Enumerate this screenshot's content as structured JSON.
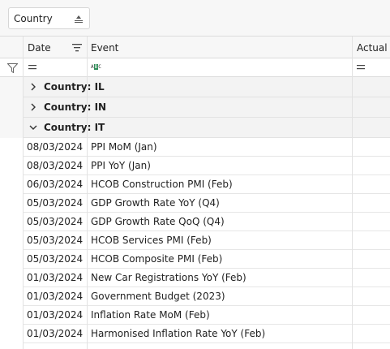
{
  "group_panel": {
    "chip_label": "Country"
  },
  "columns": {
    "date": "Date",
    "event": "Event",
    "actual": "Actual"
  },
  "groups": [
    {
      "label": "Country: IL",
      "expanded": false
    },
    {
      "label": "Country: IN",
      "expanded": false
    },
    {
      "label": "Country: IT",
      "expanded": true
    }
  ],
  "rows": [
    {
      "date": "08/03/2024",
      "event": "PPI MoM (Jan)"
    },
    {
      "date": "08/03/2024",
      "event": "PPI YoY (Jan)"
    },
    {
      "date": "06/03/2024",
      "event": "HCOB Construction PMI (Feb)"
    },
    {
      "date": "05/03/2024",
      "event": "GDP Growth Rate YoY (Q4)"
    },
    {
      "date": "05/03/2024",
      "event": "GDP Growth Rate QoQ (Q4)"
    },
    {
      "date": "05/03/2024",
      "event": "HCOB Services PMI (Feb)"
    },
    {
      "date": "05/03/2024",
      "event": "HCOB Composite PMI (Feb)"
    },
    {
      "date": "01/03/2024",
      "event": "New Car Registrations YoY (Feb)"
    },
    {
      "date": "01/03/2024",
      "event": "Government Budget (2023)"
    },
    {
      "date": "01/03/2024",
      "event": "Inflation Rate MoM (Feb)"
    },
    {
      "date": "01/03/2024",
      "event": "Harmonised Inflation Rate YoY (Feb)"
    }
  ]
}
